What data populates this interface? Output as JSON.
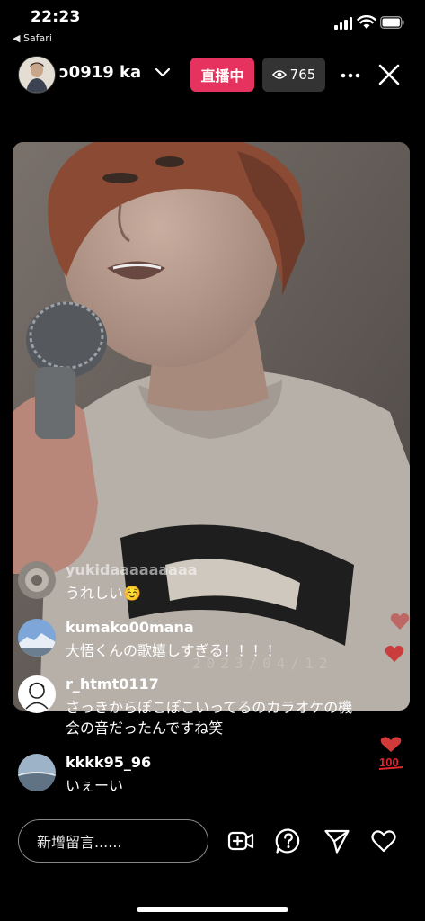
{
  "status_bar": {
    "time": "22:23",
    "back_app": "◀ Safari"
  },
  "header": {
    "host_name": "ɔ0919  ka",
    "live_label": "直播中",
    "viewer_count": "765"
  },
  "video": {
    "watermark": "2023/04/12"
  },
  "comments": [
    {
      "user": "yukidaaaaaaaaa",
      "text": "うれしい☺️"
    },
    {
      "user": "kumako00mana",
      "text": "大悟くんの歌嬉しすぎる！！！！"
    },
    {
      "user": "r_htmt0117",
      "text": "さっきからぽこぽこいってるのカラオケの機会の音だったんですね笑"
    },
    {
      "user": "kkkk95_96",
      "text": "いぇーい"
    }
  ],
  "bottom_bar": {
    "comment_placeholder": "新增留言......"
  },
  "colors": {
    "live_badge": "#e5325e",
    "viewer_badge": "#333333",
    "background": "#000000"
  },
  "icons": [
    "chevron-down-icon",
    "eye-icon",
    "more-icon",
    "close-icon",
    "add-video-icon",
    "question-icon",
    "send-icon",
    "heart-icon",
    "hundred-emoji-icon"
  ]
}
